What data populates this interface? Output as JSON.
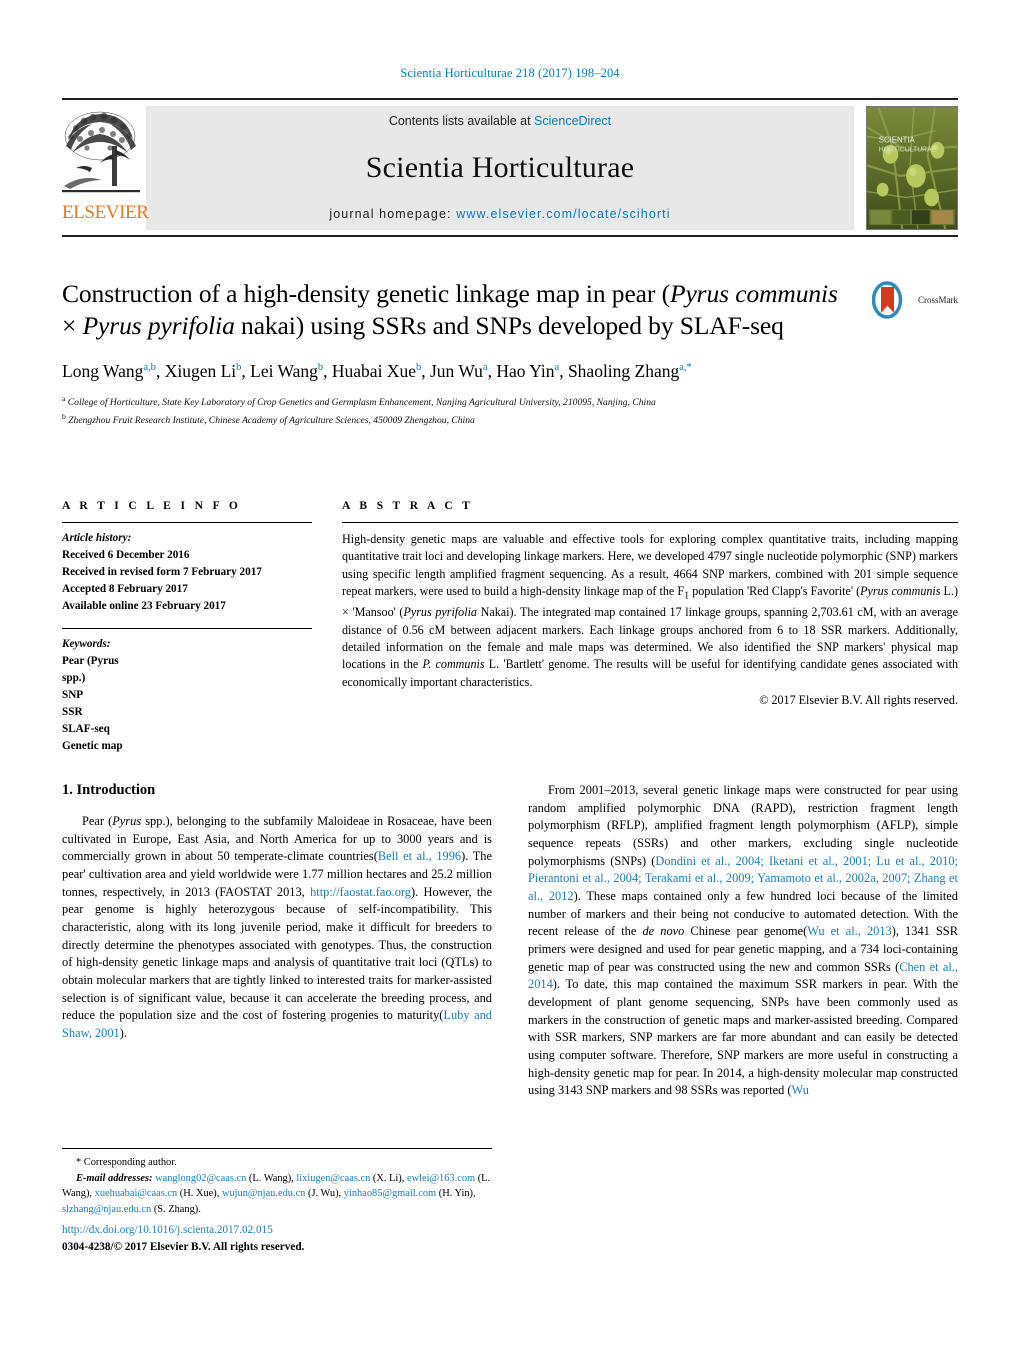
{
  "running_head": "Scientia Horticulturae 218 (2017) 198–204",
  "masthead": {
    "contents_prefix": "Contents lists available at ",
    "sciencedirect": "ScienceDirect",
    "journal_name": "Scientia Horticulturae",
    "homepage_prefix": "journal homepage: ",
    "homepage_url": "www.elsevier.com/locate/scihorti",
    "publisher": "ELSEVIER",
    "cover_title_line1": "SCIENTIA",
    "cover_title_line2": "HORTICULTURAE",
    "link_color": "#0b7bb5",
    "elsevier_orange": "#e87722"
  },
  "crossmark": {
    "label": "CrossMark"
  },
  "title": {
    "part1": "Construction of a high-density genetic linkage map in pear (",
    "italic1": "Pyrus communis",
    "mid": " × ",
    "italic2": "Pyrus pyrifolia",
    "part2": " nakai) using SSRs and SNPs developed by SLAF-seq"
  },
  "authors": {
    "list": [
      {
        "name": "Long Wang",
        "sup": "a,b"
      },
      {
        "name": "Xiugen Li",
        "sup": "b"
      },
      {
        "name": "Lei Wang",
        "sup": "b"
      },
      {
        "name": "Huabai Xue",
        "sup": "b"
      },
      {
        "name": "Jun Wu",
        "sup": "a"
      },
      {
        "name": "Hao Yin",
        "sup": "a"
      },
      {
        "name": "Shaoling Zhang",
        "sup": "a,*"
      }
    ],
    "affiliations": [
      {
        "marker": "a",
        "text": "College of Horticulture, State Key Laboratory of Crop Genetics and Germplasm Enhancement, Nanjing Agricultural University, 210095, Nanjing, China"
      },
      {
        "marker": "b",
        "text": "Zhengzhou Fruit Research Institute, Chinese Academy of Agriculture Sciences, 450009 Zhengzhou, China"
      }
    ]
  },
  "article_info": {
    "heading": "A R T I C L E   I N F O",
    "history_label": "Article history:",
    "history": [
      "Received 6 December 2016",
      "Received in revised form 7 February 2017",
      "Accepted 8 February 2017",
      "Available online 23 February 2017"
    ],
    "keywords_label": "Keywords:",
    "keywords": [
      "Pear (Pyrus",
      "spp.)",
      "SNP",
      "SSR",
      "SLAF-seq",
      "Genetic map"
    ]
  },
  "abstract": {
    "heading": "A B S T R A C T",
    "text_1": "High-density genetic maps are valuable and effective tools for exploring complex quantitative traits, including mapping quantitative trait loci and developing linkage markers. Here, we developed 4797 single nucleotide polymorphic (SNP) markers using specific length amplified fragment sequencing. As a result, 4664 SNP markers, combined with 201 simple sequence repeat markers, were used to build a high-density linkage map of the F",
    "sub_1": "1",
    "text_2": " population 'Red Clapp's Favorite' (",
    "ital_1": "Pyrus communis",
    "text_3": " L.) × 'Mansoo' (",
    "ital_2": "Pyrus pyrifolia",
    "text_4": " Nakai). The integrated map contained 17 linkage groups, spanning 2,703.61 cM, with an average distance of 0.56 cM between adjacent markers. Each linkage groups anchored from 6 to 18 SSR markers. Additionally, detailed information on the female and male maps was determined. We also identified the SNP markers' physical map locations in the ",
    "ital_3": "P. communis",
    "text_5": " L. 'Bartlett' genome. The results will be useful for identifying candidate genes associated with economically important characteristics.",
    "copyright": "© 2017 Elsevier B.V. All rights reserved."
  },
  "introduction": {
    "heading": "1.  Introduction",
    "left_p1_a": "Pear (",
    "left_p1_ital": "Pyrus",
    "left_p1_b": " spp.), belonging to the subfamily Maloideae in Rosaceae, have been cultivated in Europe, East Asia, and North America for up to 3000 years and is commercially grown in about 50 temperate-climate countries(",
    "left_ref1": "Bell et al., 1996",
    "left_p1_c": "). The pear' cultivation area and yield worldwide were 1.77 million hectares and 25.2 million tonnes, respectively, in 2013 (FAOSTAT 2013, ",
    "left_link1": "http://faostat.fao.org",
    "left_p1_d": "). However, the pear genome is highly heterozygous because of self-incompatibility. This characteristic, along with its long juvenile period, make it difficult for breeders to directly determine the phenotypes associated with genotypes. Thus, the construction of high-density genetic linkage maps and analysis of quantitative trait loci (QTLs) to obtain molecular markers that are tightly linked to interested traits for marker-assisted selection is of significant value, because it can accelerate the breeding process, and reduce the population size and the cost of fostering progenies to maturity(",
    "left_ref2": "Luby and Shaw, 2001",
    "left_p1_e": ").",
    "right_p1_a": "From 2001–2013, several genetic linkage maps were constructed for pear using random amplified polymorphic DNA (RAPD), restriction fragment length polymorphism (RFLP), amplified fragment length polymorphism (AFLP), simple sequence repeats (SSRs) and other markers, excluding single nucleotide polymorphisms (SNPs) (",
    "right_ref1": "Dondini et al., 2004; Iketani et al., 2001; Lu et al., 2010; Pierantoni et al., 2004; Terakami et al., 2009; Yamamoto et al., 2002a, 2007; Zhang et al., 2012",
    "right_p1_b": "). These maps contained only a few hundred loci because of the limited number of markers and their being not conducive to automated detection. With the recent release of the ",
    "right_ital1": "de novo",
    "right_p1_c": " Chinese pear genome(",
    "right_ref2": "Wu et al., 2013",
    "right_p1_d": "), 1341 SSR primers were designed and used for pear genetic mapping, and a 734 loci-containing genetic map of pear was constructed using the new and common SSRs (",
    "right_ref3": "Chen et al., 2014",
    "right_p1_e": "). To date, this map contained the maximum SSR markers in pear. With the development of plant genome sequencing, SNPs have been commonly used as markers in the construction of genetic maps and marker-assisted breeding. Compared with SSR markers, SNP markers are far more abundant and can easily be detected using computer software. Therefore, SNP markers are more useful in constructing a high-density genetic map for pear. In 2014, a high-density molecular map constructed using 3143 SNP markers and 98 SSRs was reported (",
    "right_ref4": "Wu"
  },
  "footnotes": {
    "corresponding": "* Corresponding author.",
    "email_label": "E-mail addresses:",
    "emails": [
      {
        "addr": "wanglong02@caas.cn",
        "who": " (L. Wang), "
      },
      {
        "addr": "lixiugen@caas.cn",
        "who": " (X. Li), "
      },
      {
        "addr": "ewlei@163.com",
        "who": " (L. Wang), "
      },
      {
        "addr": "xuehuabai@caas.cn",
        "who": " (H. Xue), "
      },
      {
        "addr": "wujun@njau.edu.cn",
        "who": " (J. Wu), "
      },
      {
        "addr": "yinhao85@gmail.com",
        "who": " (H. Yin), "
      },
      {
        "addr": "slzhang@njau.edu.cn",
        "who": " (S. Zhang)."
      }
    ],
    "doi": "http://dx.doi.org/10.1016/j.scienta.2017.02.015",
    "issn_line": "0304-4238/© 2017 Elsevier B.V. All rights reserved."
  }
}
